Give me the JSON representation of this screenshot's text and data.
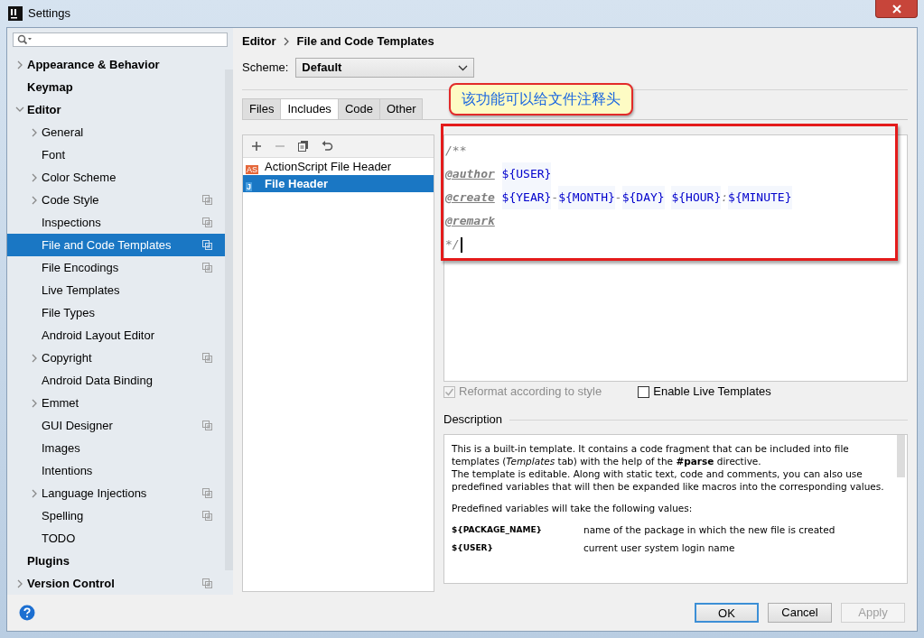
{
  "window": {
    "title": "Settings"
  },
  "sidebar": {
    "items": [
      {
        "label": "Appearance & Behavior",
        "expanded": false,
        "selected": false,
        "project_scope": false
      },
      {
        "label": "Keymap",
        "selected": false,
        "project_scope": false
      },
      {
        "label": "Editor",
        "expanded": true,
        "selected": false,
        "project_scope": false,
        "children": [
          {
            "label": "General",
            "expanded": false,
            "selected": false,
            "project_scope": false
          },
          {
            "label": "Font",
            "selected": false,
            "project_scope": false
          },
          {
            "label": "Color Scheme",
            "expanded": false,
            "selected": false,
            "project_scope": false
          },
          {
            "label": "Code Style",
            "expanded": false,
            "selected": false,
            "project_scope": true
          },
          {
            "label": "Inspections",
            "selected": false,
            "project_scope": true
          },
          {
            "label": "File and Code Templates",
            "selected": true,
            "project_scope": true
          },
          {
            "label": "File Encodings",
            "selected": false,
            "project_scope": true
          },
          {
            "label": "Live Templates",
            "selected": false,
            "project_scope": false
          },
          {
            "label": "File Types",
            "selected": false,
            "project_scope": false
          },
          {
            "label": "Android Layout Editor",
            "selected": false,
            "project_scope": false
          },
          {
            "label": "Copyright",
            "expanded": false,
            "selected": false,
            "project_scope": true
          },
          {
            "label": "Android Data Binding",
            "selected": false,
            "project_scope": false
          },
          {
            "label": "Emmet",
            "expanded": false,
            "selected": false,
            "project_scope": false
          },
          {
            "label": "GUI Designer",
            "selected": false,
            "project_scope": true
          },
          {
            "label": "Images",
            "selected": false,
            "project_scope": false
          },
          {
            "label": "Intentions",
            "selected": false,
            "project_scope": false
          },
          {
            "label": "Language Injections",
            "expanded": false,
            "selected": false,
            "project_scope": true
          },
          {
            "label": "Spelling",
            "selected": false,
            "project_scope": true
          },
          {
            "label": "TODO",
            "selected": false,
            "project_scope": false
          }
        ]
      },
      {
        "label": "Plugins",
        "selected": false,
        "project_scope": false
      },
      {
        "label": "Version Control",
        "expanded": false,
        "selected": false,
        "project_scope": true
      }
    ]
  },
  "breadcrumb": [
    "Editor",
    "File and Code Templates"
  ],
  "scheme": {
    "label": "Scheme:",
    "value": "Default"
  },
  "tabs": [
    {
      "label": "Files",
      "selected": false
    },
    {
      "label": "Includes",
      "selected": true
    },
    {
      "label": "Code",
      "selected": false
    },
    {
      "label": "Other",
      "selected": false
    }
  ],
  "toolbar": [
    {
      "kind": "add",
      "disabled": false
    },
    {
      "kind": "remove",
      "disabled": true
    },
    {
      "kind": "copy",
      "disabled": false
    },
    {
      "kind": "reset",
      "disabled": false
    }
  ],
  "templates": [
    {
      "label": "ActionScript File Header",
      "icon_text": "AS",
      "selected": false
    },
    {
      "label": "File Header",
      "icon_text": "J",
      "selected": true
    }
  ],
  "editor": {
    "lines": [
      [
        {
          "kind": "comment",
          "text": "/**"
        }
      ],
      [
        {
          "kind": "tag",
          "text": "@author"
        },
        {
          "kind": "var",
          "text": "${USER}",
          "space_before": true
        }
      ],
      [
        {
          "kind": "tag",
          "text": "@create"
        },
        {
          "kind": "var",
          "text": "${YEAR}",
          "space_before": true
        },
        {
          "kind": "comment",
          "text": "-"
        },
        {
          "kind": "var",
          "text": "${MONTH}"
        },
        {
          "kind": "comment",
          "text": "-"
        },
        {
          "kind": "var",
          "text": "${DAY}"
        },
        {
          "kind": "var",
          "text": "${HOUR}",
          "space_before": true
        },
        {
          "kind": "comment",
          "text": ":"
        },
        {
          "kind": "var",
          "text": "${MINUTE}"
        }
      ],
      [
        {
          "kind": "tag",
          "text": "@remark"
        }
      ],
      [
        {
          "kind": "comment",
          "text": "*/"
        }
      ]
    ]
  },
  "options": [
    {
      "label": "Reformat according to style",
      "checked": true,
      "disabled": true
    },
    {
      "label": "Enable Live Templates",
      "checked": false,
      "disabled": false
    }
  ],
  "description": {
    "heading": "Description",
    "paragraphs": [
      "This is a built-in template. It contains a code fragment that can be included into file templates (*Templates* tab) with the help of the **#parse** directive.",
      "The template is editable. Along with static text, code and comments, you can also use predefined variables that will then be expanded like macros into the corresponding values.",
      "Predefined variables will take the following values:"
    ],
    "variables": [
      {
        "name": "${PACKAGE_NAME}",
        "meaning": "name of the package in which the new file is created"
      },
      {
        "name": "${USER}",
        "meaning": "current user system login name"
      }
    ]
  },
  "annotation": {
    "callout": "该功能可以给文件注释头"
  },
  "buttons": [
    {
      "label": "OK",
      "default": true,
      "disabled": false
    },
    {
      "label": "Cancel",
      "default": false,
      "disabled": false
    },
    {
      "label": "Apply",
      "default": false,
      "disabled": true
    }
  ]
}
